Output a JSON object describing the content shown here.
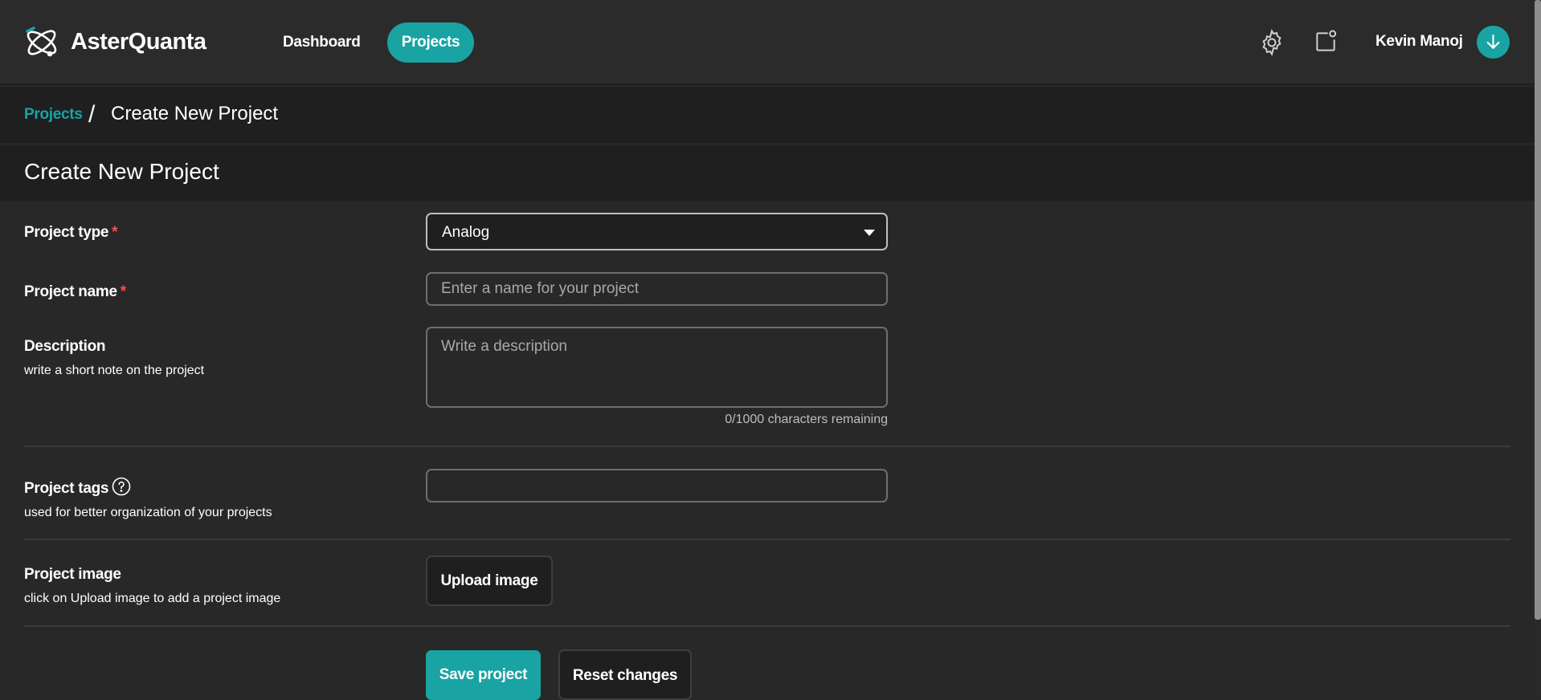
{
  "header": {
    "brand": "AsterQuanta",
    "nav": {
      "dashboard": "Dashboard",
      "projects": "Projects"
    },
    "user_name": "Kevin Manoj",
    "icons": {
      "settings": "gear-icon",
      "notifications": "notification-icon",
      "avatar": "download-arrow-icon"
    },
    "accent_color": "#1aa3a3"
  },
  "breadcrumb": {
    "parent": "Projects",
    "separator": "/",
    "current": "Create New Project"
  },
  "page_title": "Create New Project",
  "form": {
    "project_type": {
      "label": "Project type",
      "required_mark": "*",
      "value": "Analog"
    },
    "project_name": {
      "label": "Project name",
      "required_mark": "*",
      "placeholder": "Enter a name for your project",
      "value": ""
    },
    "description": {
      "label": "Description",
      "hint": "write a short note on the project",
      "placeholder": "Write a description",
      "counter": "0/1000 characters remaining"
    },
    "project_tags": {
      "label": "Project tags",
      "hint": "used for better organization of your projects",
      "value": ""
    },
    "project_image": {
      "label": "Project image",
      "hint": "click on Upload image to add a project image",
      "upload_label": "Upload image"
    },
    "actions": {
      "save_label": "Save project",
      "reset_label": "Reset changes"
    }
  }
}
